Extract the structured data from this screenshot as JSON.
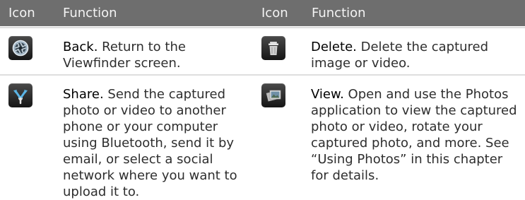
{
  "header": {
    "icon_label_1": "Icon",
    "function_label_1": "Function",
    "icon_label_2": "Icon",
    "function_label_2": "Function"
  },
  "rows": [
    {
      "icon": "camera-shutter-icon",
      "title": "Back.",
      "text": "Return to the Viewfinder screen."
    },
    {
      "icon": "trash-icon",
      "title": "Delete.",
      "text": "Delete the captured image or video."
    },
    {
      "icon": "share-icon",
      "title": "Share.",
      "text": "Send the captured photo or video to another phone or your computer using Bluetooth, send it by email, or select a social network where you want to upload it to."
    },
    {
      "icon": "photos-icon",
      "title": "View.",
      "text": "Open and use the Photos application to view the captured photo or video, rotate your captured photo, and more. See “Using Photos” in this chapter for details."
    }
  ],
  "colors": {
    "header_bg": "#6e6e6e",
    "header_text": "#f4f4f4",
    "separator": "#dedede",
    "body_text": "#2e2e2e"
  }
}
